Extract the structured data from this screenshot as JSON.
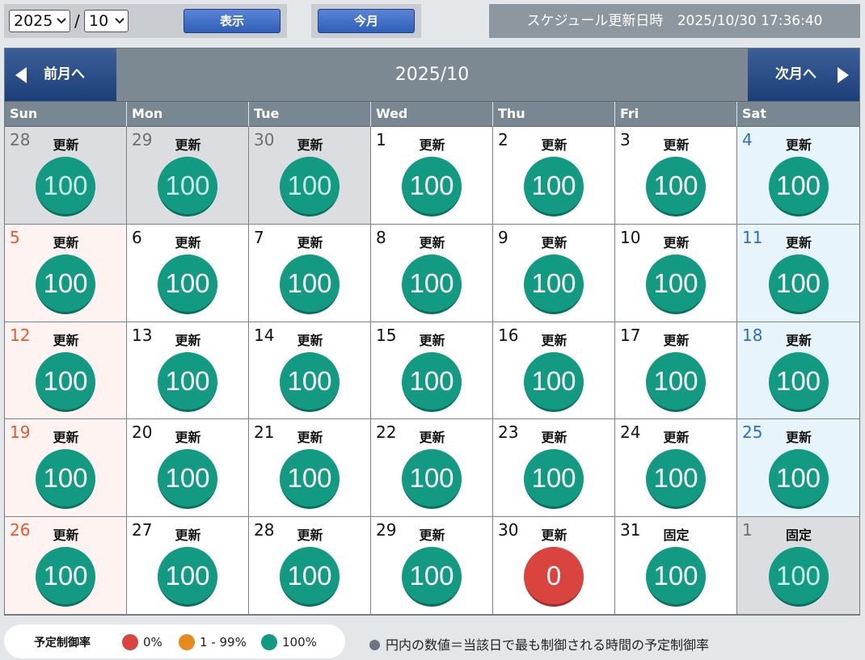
{
  "controls": {
    "year": "2025",
    "month": "10",
    "separator": "/",
    "show_label": "表示",
    "this_month_label": "今月"
  },
  "update_info": {
    "label": "スケジュール更新日時",
    "datetime": "2025/10/30 17:36:40"
  },
  "calendar": {
    "prev_label": "前月へ",
    "next_label": "次月へ",
    "title": "2025/10",
    "weekdays": [
      "Sun",
      "Mon",
      "Tue",
      "Wed",
      "Thu",
      "Fri",
      "Sat"
    ],
    "days": [
      {
        "day": "28",
        "status": "更新",
        "rate": "100",
        "type": "other"
      },
      {
        "day": "29",
        "status": "更新",
        "rate": "100",
        "type": "other"
      },
      {
        "day": "30",
        "status": "更新",
        "rate": "100",
        "type": "other"
      },
      {
        "day": "1",
        "status": "更新",
        "rate": "100",
        "type": "normal"
      },
      {
        "day": "2",
        "status": "更新",
        "rate": "100",
        "type": "normal"
      },
      {
        "day": "3",
        "status": "更新",
        "rate": "100",
        "type": "normal"
      },
      {
        "day": "4",
        "status": "更新",
        "rate": "100",
        "type": "sat"
      },
      {
        "day": "5",
        "status": "更新",
        "rate": "100",
        "type": "sun"
      },
      {
        "day": "6",
        "status": "更新",
        "rate": "100",
        "type": "normal"
      },
      {
        "day": "7",
        "status": "更新",
        "rate": "100",
        "type": "normal"
      },
      {
        "day": "8",
        "status": "更新",
        "rate": "100",
        "type": "normal"
      },
      {
        "day": "9",
        "status": "更新",
        "rate": "100",
        "type": "normal"
      },
      {
        "day": "10",
        "status": "更新",
        "rate": "100",
        "type": "normal"
      },
      {
        "day": "11",
        "status": "更新",
        "rate": "100",
        "type": "sat"
      },
      {
        "day": "12",
        "status": "更新",
        "rate": "100",
        "type": "sun"
      },
      {
        "day": "13",
        "status": "更新",
        "rate": "100",
        "type": "normal"
      },
      {
        "day": "14",
        "status": "更新",
        "rate": "100",
        "type": "normal"
      },
      {
        "day": "15",
        "status": "更新",
        "rate": "100",
        "type": "normal"
      },
      {
        "day": "16",
        "status": "更新",
        "rate": "100",
        "type": "normal"
      },
      {
        "day": "17",
        "status": "更新",
        "rate": "100",
        "type": "normal"
      },
      {
        "day": "18",
        "status": "更新",
        "rate": "100",
        "type": "sat"
      },
      {
        "day": "19",
        "status": "更新",
        "rate": "100",
        "type": "sun"
      },
      {
        "day": "20",
        "status": "更新",
        "rate": "100",
        "type": "normal"
      },
      {
        "day": "21",
        "status": "更新",
        "rate": "100",
        "type": "normal"
      },
      {
        "day": "22",
        "status": "更新",
        "rate": "100",
        "type": "normal"
      },
      {
        "day": "23",
        "status": "更新",
        "rate": "100",
        "type": "normal"
      },
      {
        "day": "24",
        "status": "更新",
        "rate": "100",
        "type": "normal"
      },
      {
        "day": "25",
        "status": "更新",
        "rate": "100",
        "type": "sat"
      },
      {
        "day": "26",
        "status": "更新",
        "rate": "100",
        "type": "sun"
      },
      {
        "day": "27",
        "status": "更新",
        "rate": "100",
        "type": "normal"
      },
      {
        "day": "28",
        "status": "更新",
        "rate": "100",
        "type": "normal"
      },
      {
        "day": "29",
        "status": "更新",
        "rate": "100",
        "type": "normal"
      },
      {
        "day": "30",
        "status": "更新",
        "rate": "0",
        "type": "normal"
      },
      {
        "day": "31",
        "status": "固定",
        "rate": "100",
        "type": "normal"
      },
      {
        "day": "1",
        "status": "固定",
        "rate": "100",
        "type": "other"
      }
    ]
  },
  "legend": {
    "title": "予定制御率",
    "items": [
      {
        "label": "0%",
        "color": "#d9443e"
      },
      {
        "label": "1 - 99%",
        "color": "#e88a1a"
      },
      {
        "label": "100%",
        "color": "#129a83"
      }
    ],
    "note": "円内の数値＝当該日で最も制御される時間の予定制御率"
  }
}
